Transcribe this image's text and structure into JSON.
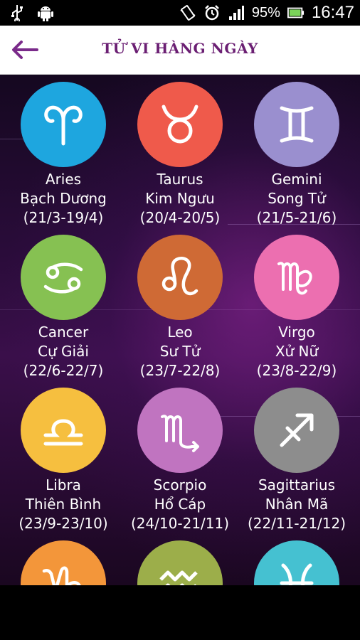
{
  "status_bar": {
    "icons_left": [
      "usb-icon",
      "android-icon"
    ],
    "icons_right": [
      "vibrate-icon",
      "alarm-icon",
      "signal-icon"
    ],
    "battery_percent": "95%",
    "time": "16:47"
  },
  "header": {
    "title": "TỬ VI HÀNG NGÀY",
    "back_icon": "arrow-left-icon",
    "accent_color": "#6b1f73"
  },
  "signs": [
    {
      "name": "Aries",
      "vn": "Bạch Dương",
      "dates": "(21/3-19/4)",
      "color": "#1ea6df",
      "icon": "aries-icon"
    },
    {
      "name": "Taurus",
      "vn": "Kim Ngưu",
      "dates": "(20/4-20/5)",
      "color": "#ef5a4b",
      "icon": "taurus-icon"
    },
    {
      "name": "Gemini",
      "vn": "Song Tử",
      "dates": "(21/5-21/6)",
      "color": "#9a8fcf",
      "icon": "gemini-icon"
    },
    {
      "name": "Cancer",
      "vn": "Cự Giải",
      "dates": "(22/6-22/7)",
      "color": "#86c152",
      "icon": "cancer-icon"
    },
    {
      "name": "Leo",
      "vn": "Sư Tử",
      "dates": "(23/7-22/8)",
      "color": "#cf6a35",
      "icon": "leo-icon"
    },
    {
      "name": "Virgo",
      "vn": "Xử Nữ",
      "dates": "(23/8-22/9)",
      "color": "#ec6fb0",
      "icon": "virgo-icon"
    },
    {
      "name": "Libra",
      "vn": "Thiên Bình",
      "dates": "(23/9-23/10)",
      "color": "#f6bf3f",
      "icon": "libra-icon"
    },
    {
      "name": "Scorpio",
      "vn": "Hổ Cáp",
      "dates": "(24/10-21/11)",
      "color": "#c074c0",
      "icon": "scorpio-icon"
    },
    {
      "name": "Sagittarius",
      "vn": "Nhân Mã",
      "dates": "(22/11-21/12)",
      "color": "#8d8d8d",
      "icon": "sagittarius-icon"
    },
    {
      "name": "",
      "vn": "",
      "dates": "",
      "color": "#f3963a",
      "icon": "capricorn-icon"
    },
    {
      "name": "",
      "vn": "",
      "dates": "",
      "color": "#9cae4a",
      "icon": "aquarius-icon"
    },
    {
      "name": "",
      "vn": "",
      "dates": "",
      "color": "#45c1d1",
      "icon": "pisces-icon"
    }
  ]
}
